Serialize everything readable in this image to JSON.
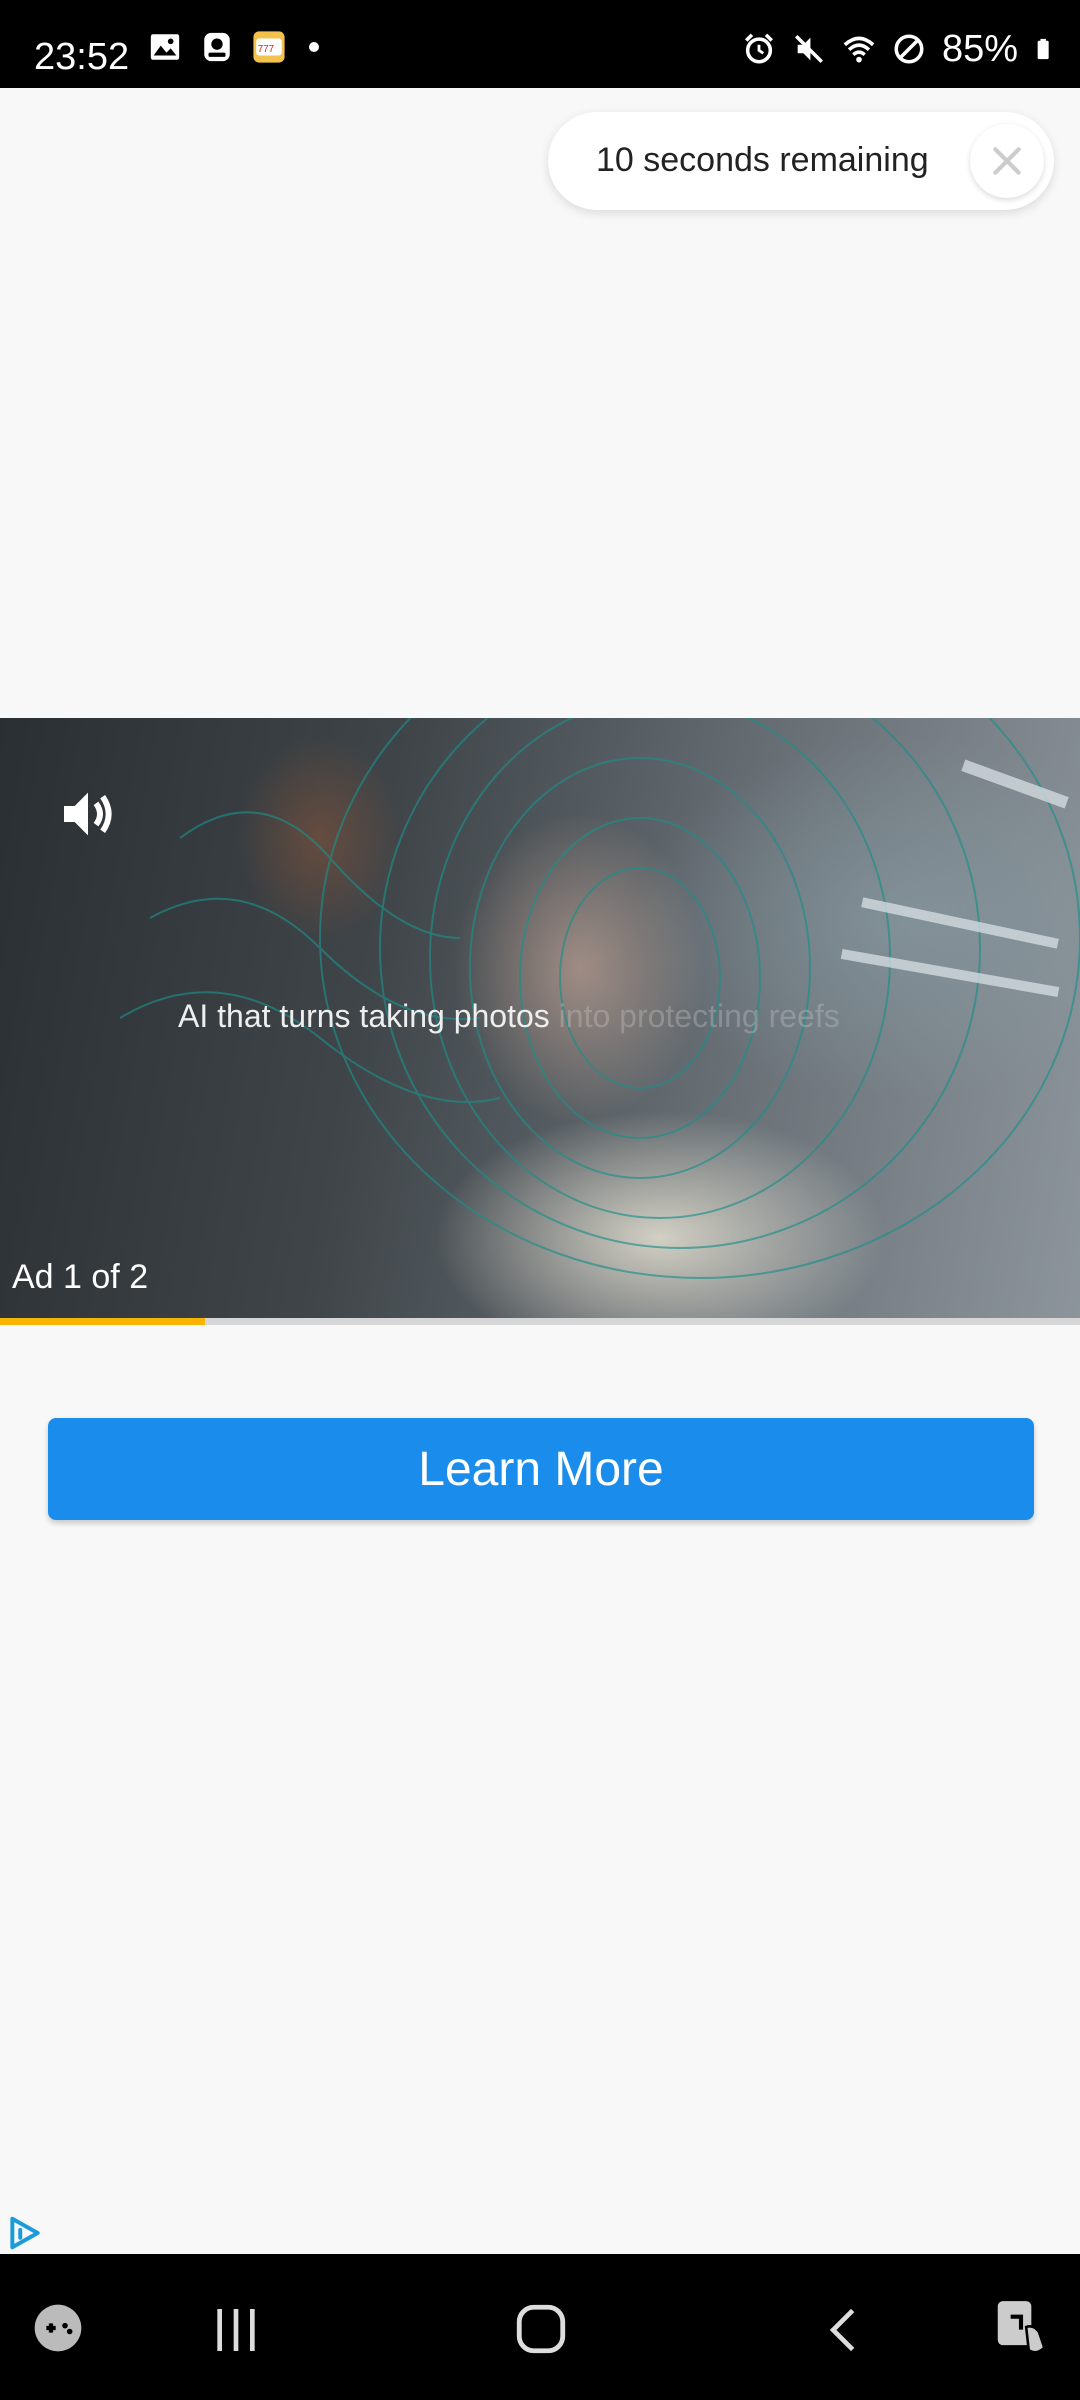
{
  "status_bar": {
    "time": "23:52",
    "battery": "85%",
    "left_icons": [
      "gallery-icon",
      "notification-icon",
      "slots-app-icon",
      "dot-icon"
    ],
    "right_icons": [
      "alarm-icon",
      "mute-icon",
      "wifi-icon",
      "do-not-disturb-icon",
      "battery-icon"
    ]
  },
  "countdown": {
    "text": "10 seconds remaining",
    "close_icon": "close-icon"
  },
  "video": {
    "subtitle_main": "AI that turns taking photos",
    "subtitle_faded": " into protecting reefs",
    "ad_counter": "Ad 1 of 2",
    "progress": 0.19,
    "sound_icon": "volume-icon"
  },
  "cta": {
    "label": "Learn More"
  },
  "nav_bar": {
    "icons": [
      "game-launcher-icon",
      "recent-apps-icon",
      "home-icon",
      "back-icon",
      "screen-assist-icon"
    ]
  },
  "colors": {
    "cta": "#1a8cec",
    "progress": "#f7b500",
    "background": "#f8f8f8"
  }
}
